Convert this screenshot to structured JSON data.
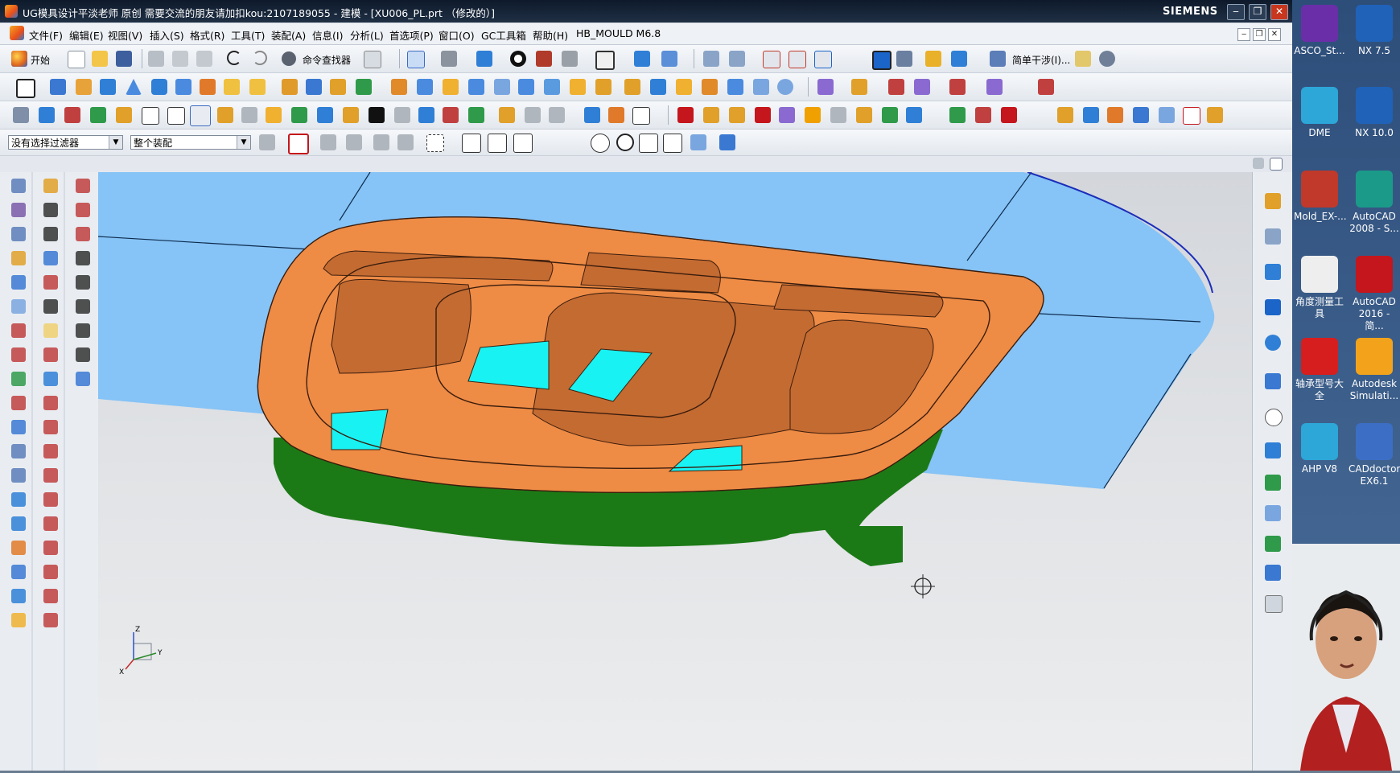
{
  "window": {
    "title": "UG模具设计平淡老师 原创 需要交流的朋友请加扣kou:2107189055 - 建模 - [XU006_PL.prt （修改的）]",
    "brand": "SIEMENS",
    "controls": [
      "‒",
      "❐",
      "✕"
    ]
  },
  "menu": {
    "items": [
      "文件(F)",
      "编辑(E)",
      "视图(V)",
      "插入(S)",
      "格式(R)",
      "工具(T)",
      "装配(A)",
      "信息(I)",
      "分析(L)",
      "首选项(P)",
      "窗口(O)",
      "GC工具箱",
      "帮助(H)",
      "HB_MOULD M6.8"
    ],
    "doc_controls": [
      "‒",
      "❐",
      "✕"
    ]
  },
  "toolbar1": {
    "start_label": "开始",
    "command_finder_label": "命令查找器",
    "simple_interference_label": "简单干涉(I)..."
  },
  "selection_bar": {
    "filter_value": "没有选择过滤器",
    "scope_value": "整个装配"
  },
  "viewport": {
    "triad": {
      "z": "Z",
      "y": "Y",
      "x": "X"
    },
    "colors": {
      "parting_surface": "#86c3f6",
      "core_top": "#ee8b45",
      "core_wall": "#c46b32",
      "base": "#1c7a16",
      "openings": "#18f2f2",
      "outline": "#3a1d0d"
    }
  },
  "desktop": {
    "icons": [
      {
        "label": "ASCO_St...",
        "color": "#6a2fa8"
      },
      {
        "label": "NX 7.5",
        "color": "#1f62b8"
      },
      {
        "label": "DME",
        "color": "#2da6d8"
      },
      {
        "label": "NX 10.0",
        "color": "#1f62b8"
      },
      {
        "label": "Mold_EX-...",
        "color": "#c0392b"
      },
      {
        "label": "AutoCAD 2008 - S...",
        "color": "#1b9a8a"
      },
      {
        "label": "角度测量工具",
        "color": "#eeeeee"
      },
      {
        "label": "AutoCAD 2016 - 简...",
        "color": "#c4161c"
      },
      {
        "label": "轴承型号大全",
        "color": "#d61e1e"
      },
      {
        "label": "Autodesk Simulati...",
        "color": "#f2a31b"
      },
      {
        "label": "AHP V8",
        "color": "#2da6d8"
      },
      {
        "label": "CADdoctor EX6.1",
        "color": "#3b6ec4"
      }
    ]
  }
}
